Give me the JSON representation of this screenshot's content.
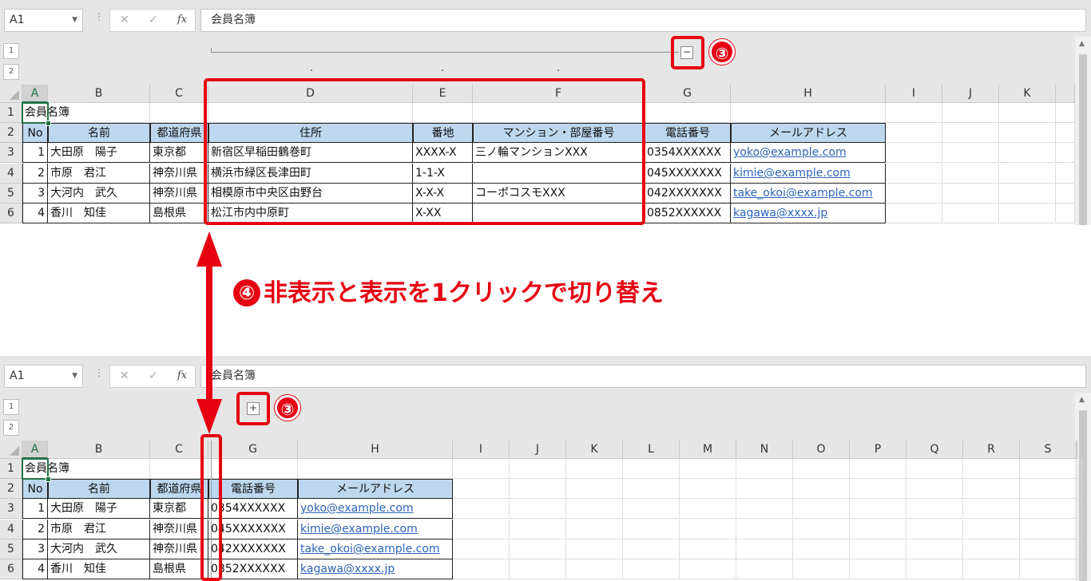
{
  "namebox": "A1",
  "formula_icons": {
    "cancel": "✕",
    "enter": "✓",
    "fx": "fx"
  },
  "formula_value": "会員名簿",
  "outline_levels": [
    "1",
    "2"
  ],
  "collapse_button": "−",
  "expand_button": "+",
  "step3_label": "③",
  "caption": {
    "num": "④",
    "text": "非表示と表示を1クリックで切り替え"
  },
  "top_sheet": {
    "columns": [
      "A",
      "B",
      "C",
      "D",
      "E",
      "F",
      "G",
      "H",
      "I",
      "J",
      "K"
    ],
    "rows": [
      "1",
      "2",
      "3",
      "4",
      "5",
      "6"
    ],
    "title": "会員名簿",
    "headers": [
      "No",
      "名前",
      "都道府県",
      "住所",
      "番地",
      "マンション・部屋番号",
      "電話番号",
      "メールアドレス"
    ],
    "data": [
      [
        "1",
        "大田原　陽子",
        "東京都",
        "新宿区早稲田鶴巻町",
        "XXXX-X",
        "三ノ輪マンションXXX",
        "0354XXXXXX",
        "yoko@example.com"
      ],
      [
        "2",
        "市原　君江",
        "神奈川県",
        "横浜市緑区長津田町",
        "1-1-X",
        "",
        "045XXXXXXX",
        "kimie@example.com"
      ],
      [
        "3",
        "大河内　武久",
        "神奈川県",
        "相模原市中央区由野台",
        "X-X-X",
        "コーポコスモXXX",
        "042XXXXXXX",
        "take_okoi@example.com"
      ],
      [
        "4",
        "香川　知佳",
        "島根県",
        "松江市内中原町",
        "X-XX",
        "",
        "0852XXXXXX",
        "kagawa@xxxx.jp"
      ]
    ]
  },
  "bottom_sheet": {
    "columns": [
      "A",
      "B",
      "C",
      "G",
      "H",
      "I",
      "J",
      "K",
      "L",
      "M",
      "N",
      "O",
      "P",
      "Q",
      "R",
      "S"
    ],
    "rows": [
      "1",
      "2",
      "3",
      "4",
      "5",
      "6"
    ],
    "title": "会員名簿",
    "headers": [
      "No",
      "名前",
      "都道府県",
      "電話番号",
      "メールアドレス"
    ],
    "data": [
      [
        "1",
        "大田原　陽子",
        "東京都",
        "0354XXXXXX",
        "yoko@example.com"
      ],
      [
        "2",
        "市原　君江",
        "神奈川県",
        "045XXXXXXX",
        "kimie@example.com"
      ],
      [
        "3",
        "大河内　武久",
        "神奈川県",
        "042XXXXXXX",
        "take_okoi@example.com"
      ],
      [
        "4",
        "香川　知佳",
        "島根県",
        "0852XXXXXX",
        "kagawa@xxxx.jp"
      ]
    ]
  }
}
